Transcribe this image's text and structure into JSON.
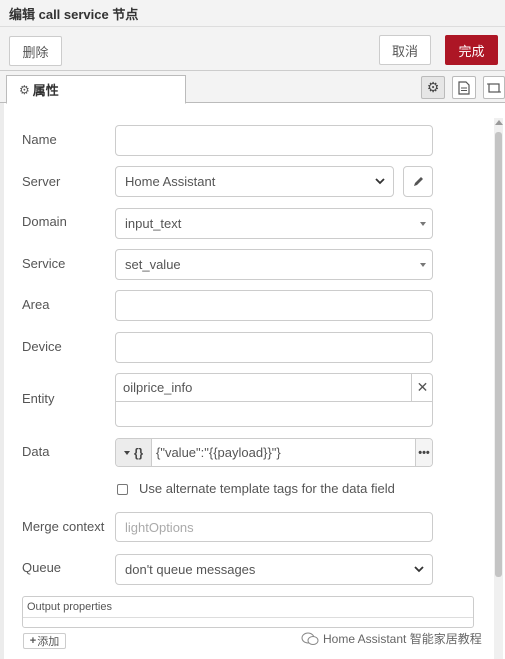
{
  "title": "编辑 call service 节点",
  "toolbar": {
    "delete_label": "删除",
    "cancel_label": "取消",
    "done_label": "完成",
    "done_color": "#ad1625"
  },
  "tabs": {
    "properties_label": "属性"
  },
  "form": {
    "name": {
      "label": "Name",
      "value": ""
    },
    "server": {
      "label": "Server",
      "value": "Home Assistant"
    },
    "domain": {
      "label": "Domain",
      "value": "input_text"
    },
    "service": {
      "label": "Service",
      "value": "set_value"
    },
    "area": {
      "label": "Area",
      "value": ""
    },
    "device": {
      "label": "Device",
      "value": ""
    },
    "entity": {
      "label": "Entity",
      "value": "oilprice_info"
    },
    "data": {
      "label": "Data",
      "type_icon": "{}",
      "value": "{\"value\":\"{{payload}}\"}"
    },
    "alt_template": {
      "label": "Use alternate template tags for the data field",
      "checked": false
    },
    "merge_context": {
      "label": "Merge context",
      "placeholder": "lightOptions"
    },
    "queue": {
      "label": "Queue",
      "value": "don't queue messages"
    },
    "output": {
      "label": "Output properties",
      "add_label": "添加"
    }
  },
  "watermark": "Home Assistant 智能家居教程",
  "icons": {
    "gear": "gear-icon",
    "document": "document-icon",
    "frame": "frame-icon",
    "pencil": "pencil-icon",
    "close": "close-icon",
    "plus": "plus-icon"
  }
}
